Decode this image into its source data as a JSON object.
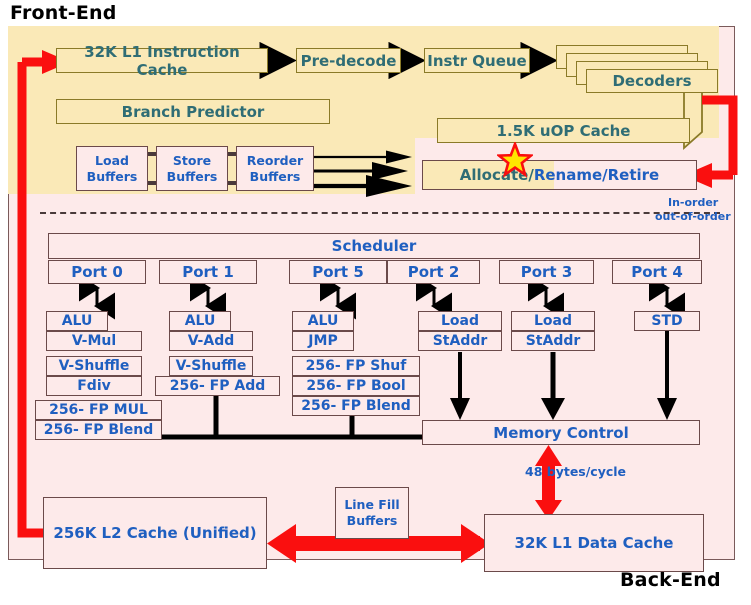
{
  "labels": {
    "front_end": "Front-End",
    "back_end": "Back-End",
    "in_order": "In-order",
    "out_of_order": "out-of-order",
    "bytes_per_cycle": "48 bytes/cycle"
  },
  "front_end": {
    "l1_instruction_cache": "32K L1 Instruction Cache",
    "pre_decode": "Pre-decode",
    "instr_queue": "Instr Queue",
    "decoders": "Decoders",
    "branch_predictor": "Branch Predictor",
    "uop_cache": "1.5K uOP Cache"
  },
  "allocate": {
    "segment_a": "Allocate/",
    "segment_b": "Rename/Retire"
  },
  "buffers": {
    "load": "Load\nBuffers",
    "load_line1": "Load",
    "load_line2": "Buffers",
    "store_line1": "Store",
    "store_line2": "Buffers",
    "reorder_line1": "Reorder",
    "reorder_line2": "Buffers"
  },
  "scheduler": {
    "label": "Scheduler"
  },
  "ports": [
    {
      "name": "Port 0",
      "units": [
        "ALU",
        "V-Mul",
        "V-Shuffle",
        "Fdiv",
        "256- FP MUL",
        "256- FP Blend"
      ]
    },
    {
      "name": "Port 1",
      "units": [
        "ALU",
        "V-Add",
        "V-Shuffle",
        "256- FP Add"
      ]
    },
    {
      "name": "Port 5",
      "units": [
        "ALU",
        "JMP",
        "256- FP Shuf",
        "256- FP Bool",
        "256- FP Blend"
      ]
    },
    {
      "name": "Port 2",
      "units": [
        "Load",
        "StAddr"
      ]
    },
    {
      "name": "Port 3",
      "units": [
        "Load",
        "StAddr"
      ]
    },
    {
      "name": "Port 4",
      "units": [
        "STD"
      ]
    }
  ],
  "memory": {
    "memory_control": "Memory Control",
    "l2_cache": "256K L2 Cache (Unified)",
    "line_fill_line1": "Line Fill",
    "line_fill_line2": "Buffers",
    "l1_data_cache": "32K L1 Data Cache"
  },
  "colors": {
    "front_end_bg": "#fae9b7",
    "back_end_bg": "#fdeaea",
    "front_end_text": "#2f6d75",
    "back_end_text": "#1f5fc0",
    "front_end_border": "#8a7a28",
    "back_end_border": "#6b4a4a",
    "red_path": "#fa0f0f",
    "star_fill": "#ffe500",
    "star_stroke": "#fa0f0f"
  },
  "icons": {
    "star": "star-icon",
    "mux": "mux-icon"
  }
}
